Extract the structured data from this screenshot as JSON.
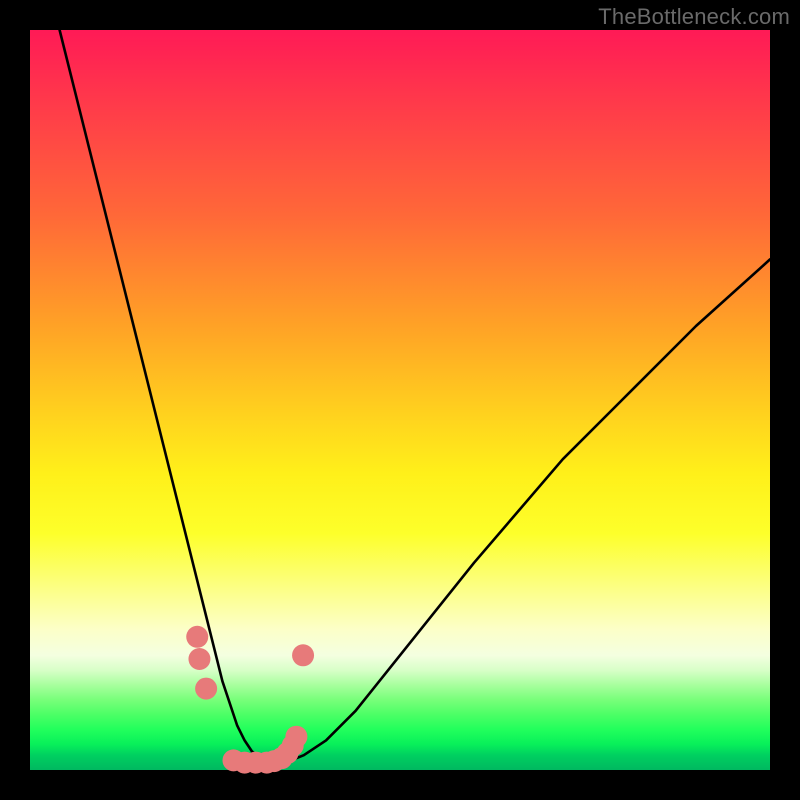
{
  "watermark": "TheBottleneck.com",
  "chart_data": {
    "type": "line",
    "title": "",
    "xlabel": "",
    "ylabel": "",
    "xlim": [
      0,
      100
    ],
    "ylim": [
      0,
      100
    ],
    "grid": false,
    "series": [
      {
        "name": "bottleneck-curve",
        "color": "#000000",
        "x": [
          4,
          6,
          8,
          10,
          12,
          14,
          16,
          18,
          20,
          21,
          22,
          23,
          24,
          25,
          26,
          27,
          28,
          29,
          30,
          31,
          32,
          33,
          34,
          35,
          37,
          40,
          44,
          48,
          52,
          56,
          60,
          66,
          72,
          80,
          90,
          100
        ],
        "y": [
          100,
          92,
          84,
          76,
          68,
          60,
          52,
          44,
          36,
          32,
          28,
          24,
          20,
          16,
          12,
          9,
          6,
          4,
          2.5,
          1.8,
          1.3,
          1,
          1,
          1.2,
          2,
          4,
          8,
          13,
          18,
          23,
          28,
          35,
          42,
          50,
          60,
          69
        ]
      },
      {
        "name": "highlight-dots",
        "color": "#e77a7a",
        "type": "scatter",
        "x": [
          22.6,
          22.9,
          23.8,
          27.5,
          29.0,
          30.5,
          32.0,
          33.0,
          34.0,
          34.8,
          35.5,
          36.0,
          36.9
        ],
        "y": [
          18.0,
          15.0,
          11.0,
          1.3,
          1.0,
          1.0,
          1.0,
          1.2,
          1.6,
          2.3,
          3.3,
          4.5,
          15.5
        ]
      }
    ]
  },
  "colors": {
    "frame": "#000000",
    "curve": "#000000",
    "dots": "#e77a7a"
  }
}
